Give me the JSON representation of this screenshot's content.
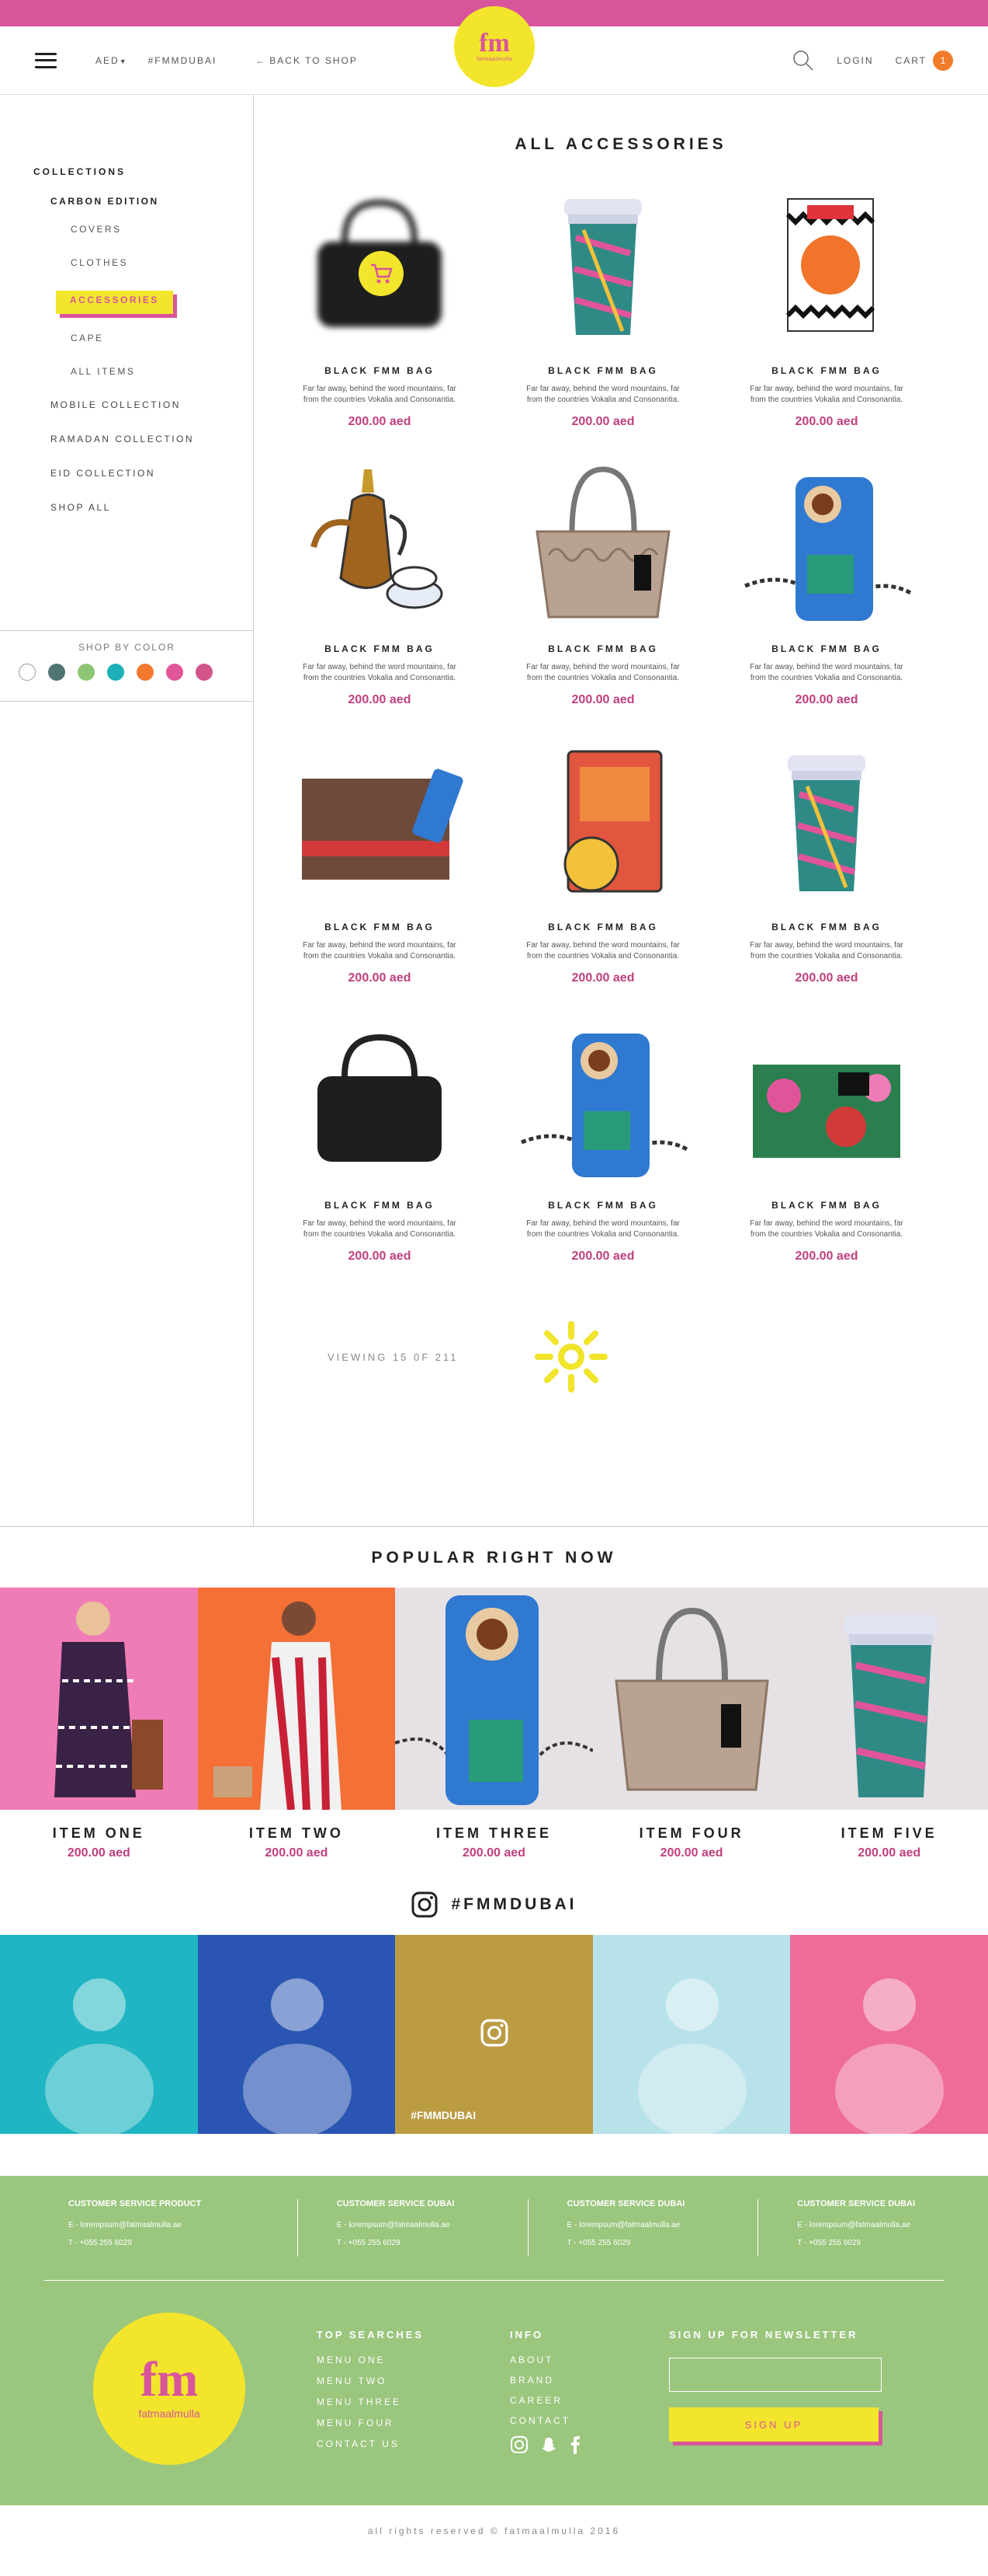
{
  "header": {
    "currency": "AED",
    "hashtag": "#FMMDUBAI",
    "back": "BACK TO SHOP",
    "login": "LOGIN",
    "cart": "CART",
    "cart_count": "1",
    "logo_mark": "fm",
    "logo_wordmark": "fatmaalmulla"
  },
  "sidebar": {
    "collections_title": "COLLECTIONS",
    "sub_title": "CARBON EDITION",
    "sub_items": [
      "COVERS",
      "CLOTHES",
      "ACCESSORIES",
      "CAPE",
      "ALL ITEMS"
    ],
    "links": [
      "MOBILE COLLECTION",
      "RAMADAN COLLECTION",
      "EID COLLECTION",
      "SHOP ALL"
    ],
    "color_title": "SHOP BY COLOR",
    "colors": [
      "#ffffff",
      "#4f7573",
      "#8ec574",
      "#1cb0b7",
      "#f3792f",
      "#e0559a",
      "#d2548a"
    ]
  },
  "main": {
    "title": "ALL ACCESSORIES",
    "products": [
      {
        "name": "BLACK FMM BAG",
        "desc": "Far far away, behind the word mountains, far from the countries Vokalia and Consonantia.",
        "price": "200.00 aed",
        "icon": "handbag-icon"
      },
      {
        "name": "BLACK FMM BAG",
        "desc": "Far far away, behind the word mountains, far from the countries Vokalia and Consonantia.",
        "price": "200.00 aed",
        "icon": "coffee-cup-icon"
      },
      {
        "name": "BLACK FMM BAG",
        "desc": "Far far away, behind the word mountains, far from the countries Vokalia and Consonantia.",
        "price": "200.00 aed",
        "icon": "notebook-icon"
      },
      {
        "name": "BLACK FMM BAG",
        "desc": "Far far away, behind the word mountains, far from the countries Vokalia and Consonantia.",
        "price": "200.00 aed",
        "icon": "coffee-pot-icon"
      },
      {
        "name": "BLACK FMM BAG",
        "desc": "Far far away, behind the word mountains, far from the countries Vokalia and Consonantia.",
        "price": "200.00 aed",
        "icon": "tote-bag-icon"
      },
      {
        "name": "BLACK FMM BAG",
        "desc": "Far far away, behind the word mountains, far from the countries Vokalia and Consonantia.",
        "price": "200.00 aed",
        "icon": "phone-case-icon"
      },
      {
        "name": "BLACK FMM BAG",
        "desc": "Far far away, behind the word mountains, far from the countries Vokalia and Consonantia.",
        "price": "200.00 aed",
        "icon": "clutch-icon"
      },
      {
        "name": "BLACK FMM BAG",
        "desc": "Far far away, behind the word mountains, far from the countries Vokalia and Consonantia.",
        "price": "200.00 aed",
        "icon": "book-icon"
      },
      {
        "name": "BLACK FMM BAG",
        "desc": "Far far away, behind the word mountains, far from the countries Vokalia and Consonantia.",
        "price": "200.00 aed",
        "icon": "coffee-cup-icon"
      },
      {
        "name": "BLACK FMM BAG",
        "desc": "Far far away, behind the word mountains, far from the countries Vokalia and Consonantia.",
        "price": "200.00 aed",
        "icon": "handbag-icon"
      },
      {
        "name": "BLACK FMM BAG",
        "desc": "Far far away, behind the word mountains, far from the countries Vokalia and Consonantia.",
        "price": "200.00 aed",
        "icon": "phone-case-icon"
      },
      {
        "name": "BLACK FMM BAG",
        "desc": "Far far away, behind the word mountains, far from the countries Vokalia and Consonantia.",
        "price": "200.00 aed",
        "icon": "floral-clutch-icon"
      }
    ],
    "pager": "VIEWING 15 0F 211"
  },
  "popular": {
    "title": "POPULAR RIGHT NOW",
    "items": [
      {
        "name": "ITEM ONE",
        "price": "200.00 aed",
        "bg": "#f07cb7"
      },
      {
        "name": "ITEM TWO",
        "price": "200.00 aed",
        "bg": "#f47036"
      },
      {
        "name": "ITEM THREE",
        "price": "200.00 aed",
        "bg": "#e6e1e5"
      },
      {
        "name": "ITEM FOUR",
        "price": "200.00 aed",
        "bg": "#e6e1e5"
      },
      {
        "name": "ITEM FIVE",
        "price": "200.00 aed",
        "bg": "#e6e1e5"
      }
    ]
  },
  "instagram": {
    "title": "#FMMDUBAI",
    "overlay_tag": "#FMMDUBAI",
    "tiles": [
      "#1fb5c2",
      "#2a55b2",
      "#f3c23a",
      "#b8e2ea",
      "#ef6c9a"
    ]
  },
  "footer": {
    "services": [
      {
        "title": "CUSTOMER SERVICE PRODUCT",
        "email": "E - lorempsum@fatmaalmulla.ae",
        "phone": "T - +055 255 6029"
      },
      {
        "title": "CUSTOMER SERVICE DUBAI",
        "email": "E - lorempsum@fatmaalmulla.ae",
        "phone": "T - +055 255 6029"
      },
      {
        "title": "CUSTOMER SERVICE DUBAI",
        "email": "E - lorempsum@fatmaalmulla.ae",
        "phone": "T - +055 255 6029"
      },
      {
        "title": "CUSTOMER SERVICE DUBAI",
        "email": "E - lorempsum@fatmaalmulla.ae",
        "phone": "T - +055 255 6029"
      }
    ],
    "logo_mark": "fm",
    "logo_wordmark": "fatmaalmulla",
    "top_searches_title": "TOP SEARCHES",
    "top_searches": [
      "MENU ONE",
      "MENU TWO",
      "MENU THREE",
      "MENU FOUR",
      "CONTACT US"
    ],
    "info_title": "INFO",
    "info_links": [
      "ABOUT",
      "BRAND",
      "CAREER",
      "CONTACT"
    ],
    "newsletter_title": "SIGN UP FOR NEWSLETTER",
    "newsletter_placeholder": "",
    "signup_label": "SIGN UP",
    "copyright": "all rights reserved © fatmaalmulla 2016"
  }
}
